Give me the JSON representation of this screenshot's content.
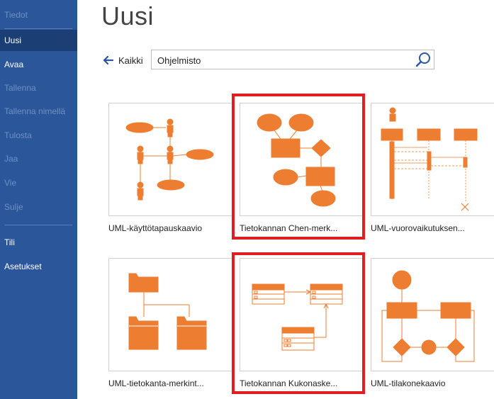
{
  "sidebar": {
    "items": [
      {
        "label": "Tiedot",
        "state": "disabled"
      },
      {
        "label": "Uusi",
        "state": "selected"
      },
      {
        "label": "Avaa",
        "state": "enabled"
      },
      {
        "label": "Tallenna",
        "state": "disabled"
      },
      {
        "label": "Tallenna nimellä",
        "state": "disabled"
      },
      {
        "label": "Tulosta",
        "state": "disabled"
      },
      {
        "label": "Jaa",
        "state": "disabled"
      },
      {
        "label": "Vie",
        "state": "disabled"
      },
      {
        "label": "Sulje",
        "state": "disabled"
      },
      {
        "label": "Tili",
        "state": "enabled"
      },
      {
        "label": "Asetukset",
        "state": "enabled"
      }
    ]
  },
  "page": {
    "title": "Uusi"
  },
  "back_nav": {
    "label": "Kaikki",
    "icon": "arrow-left-icon"
  },
  "search": {
    "value": "Ohjelmisto",
    "icon": "search-icon"
  },
  "templates": [
    {
      "label": "UML-käyttötapauskaavio",
      "highlighted": false
    },
    {
      "label": "Tietokannan Chen-merk...",
      "highlighted": true
    },
    {
      "label": "UML-vuorovaikutuksen...",
      "highlighted": false
    },
    {
      "label": "UML-tietokanta-merkint...",
      "highlighted": false
    },
    {
      "label": "Tietokannan Kukonaske...",
      "highlighted": true
    },
    {
      "label": "UML-tilakonekaavio",
      "highlighted": false
    }
  ],
  "colors": {
    "sidebar": "#2b579a",
    "sidebar_selected": "#1b3f75",
    "accent_orange": "#ed7d31",
    "highlight_red": "#e11d24"
  }
}
